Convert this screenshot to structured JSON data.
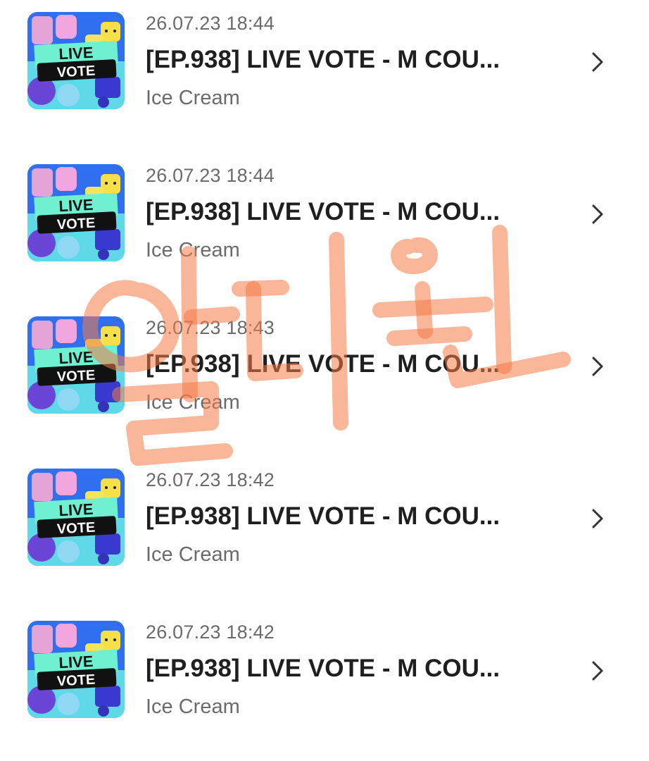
{
  "items": [
    {
      "timestamp": "26.07.23 18:44",
      "title": "[EP.938] LIVE VOTE - M COU...",
      "subtitle": "Ice Cream",
      "thumb_text_1": "LIVE",
      "thumb_text_2": "VOTE"
    },
    {
      "timestamp": "26.07.23 18:44",
      "title": "[EP.938] LIVE VOTE - M COU...",
      "subtitle": "Ice Cream",
      "thumb_text_1": "LIVE",
      "thumb_text_2": "VOTE"
    },
    {
      "timestamp": "26.07.23 18:43",
      "title": "[EP.938] LIVE VOTE - M COU...",
      "subtitle": "Ice Cream",
      "thumb_text_1": "LIVE",
      "thumb_text_2": "VOTE"
    },
    {
      "timestamp": "26.07.23 18:42",
      "title": "[EP.938] LIVE VOTE - M COU...",
      "subtitle": "Ice Cream",
      "thumb_text_1": "LIVE",
      "thumb_text_2": "VOTE"
    },
    {
      "timestamp": "26.07.23 18:42",
      "title": "[EP.938] LIVE VOTE - M COU...",
      "subtitle": "Ice Cream",
      "thumb_text_1": "LIVE",
      "thumb_text_2": "VOTE"
    }
  ],
  "icons": {
    "chevron": "chevron-right-icon",
    "thumbnail": "live-vote-thumbnail"
  },
  "colors": {
    "timestamp": "#6b6b6b",
    "title": "#1f1f1f",
    "watermark": "#f47a45"
  }
}
